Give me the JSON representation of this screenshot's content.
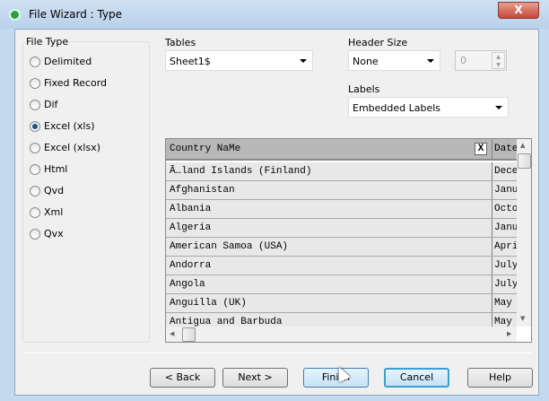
{
  "window": {
    "title": "File Wizard : Type",
    "close_label": "X"
  },
  "file_type": {
    "label": "File Type",
    "options": [
      "Delimited",
      "Fixed Record",
      "Dif",
      "Excel (xls)",
      "Excel (xlsx)",
      "Html",
      "Qvd",
      "Xml",
      "Qvx"
    ],
    "selected": "Excel (xls)"
  },
  "tables": {
    "label": "Tables",
    "value": "Sheet1$"
  },
  "header_size": {
    "label": "Header Size",
    "value": "None",
    "spinner_value": "0"
  },
  "labels": {
    "label": "Labels",
    "value": "Embedded Labels"
  },
  "grid": {
    "columns": [
      "Country NaMe",
      "Date"
    ],
    "close_label": "X",
    "rows": [
      [
        "Ã…land Islands (Finland)",
        "Dece"
      ],
      [
        "Afghanistan",
        "Janu"
      ],
      [
        "Albania",
        "Octo"
      ],
      [
        "Algeria",
        "Janu"
      ],
      [
        "American Samoa (USA)",
        "Apri"
      ],
      [
        "Andorra",
        "July"
      ],
      [
        "Angola",
        "July"
      ],
      [
        "Anguilla (UK)",
        "May"
      ],
      [
        "Antigua and Barbuda",
        "May"
      ]
    ]
  },
  "buttons": {
    "back": "< Back",
    "next": "Next >",
    "finish": "Finish",
    "cancel": "Cancel",
    "help": "Help"
  }
}
